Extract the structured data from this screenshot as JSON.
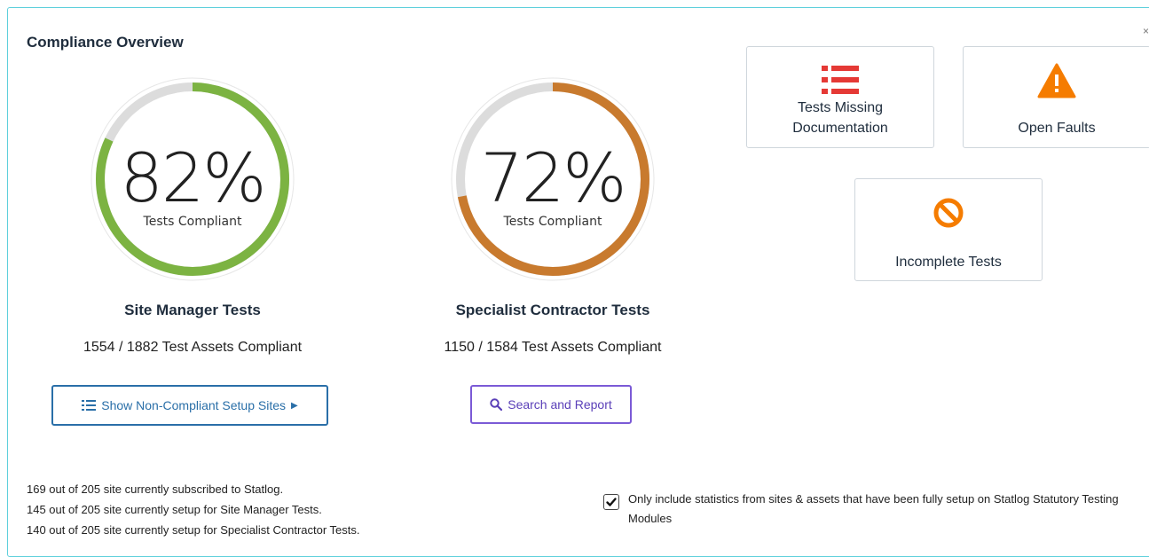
{
  "overview": {
    "title": "Compliance Overview"
  },
  "gauges": [
    {
      "percent": "82%",
      "fraction": 0.82,
      "sublabel": "Tests Compliant",
      "name": "Site Manager Tests",
      "count_text": "1554 / 1882 Test Assets Compliant",
      "color": "#7cb342"
    },
    {
      "percent": "72%",
      "fraction": 0.72,
      "sublabel": "Tests Compliant",
      "name": "Specialist Contractor Tests",
      "count_text": "1150 / 1584 Test Assets Compliant",
      "color": "#c87a2e"
    }
  ],
  "buttons": {
    "show_noncompliant": "Show Non-Compliant Setup Sites",
    "search_report": "Search and Report"
  },
  "cards": {
    "missing_docs_line1": "Tests Missing",
    "missing_docs_line2": "Documentation",
    "open_faults": "Open Faults",
    "incomplete_tests": "Incomplete Tests"
  },
  "footer": {
    "line1": "169 out of 205 site currently subscribed to Statlog.",
    "line2": "145 out of 205 site currently setup for Site Manager Tests.",
    "line3": "140 out of 205 site currently setup for Specialist Contractor Tests."
  },
  "filter": {
    "checked": true,
    "label": "Only include statistics from sites & assets that have been fully setup on Statlog Statutory Testing Modules"
  },
  "colors": {
    "accent_blue": "#2a6fa8",
    "accent_purple": "#7b5ad6",
    "red_icon": "#e53935",
    "orange_icon": "#f57c00"
  }
}
